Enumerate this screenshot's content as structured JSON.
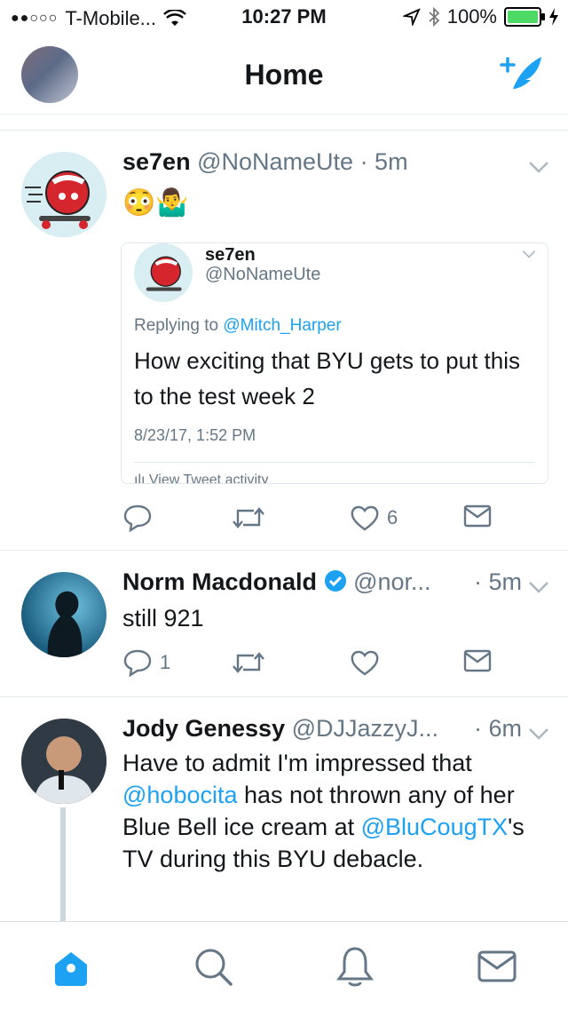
{
  "status_bar": {
    "signal": "●●○○○",
    "carrier": "T-Mobile...",
    "time": "10:27 PM",
    "battery": "100%"
  },
  "header": {
    "title": "Home"
  },
  "tweets": [
    {
      "name": "se7en",
      "handle": "@NoNameUte",
      "time": "· 5m",
      "text": "😳🤷‍♂️",
      "quote": {
        "name": "se7en",
        "handle": "@NoNameUte",
        "reply_prefix": "Replying to ",
        "reply_to": "@Mitch_Harper",
        "text": "How exciting that BYU gets to put this to the test week 2",
        "date": "8/23/17, 1:52 PM",
        "cut_text": "ılı View Tweet activity"
      },
      "likes": "6"
    },
    {
      "name": "Norm Macdonald",
      "handle": "@nor...",
      "time": "· 5m",
      "text": "still 921",
      "replies": "1"
    },
    {
      "name": "Jody Genessy",
      "handle": "@DJJazzyJ...",
      "time": "· 6m",
      "text_parts": [
        "Have to admit I'm impressed that ",
        "@hobocita",
        " has not thrown any of her Blue Bell ice cream at ",
        "@BluCougTX",
        "'s TV during this BYU debacle."
      ]
    }
  ],
  "tabbar": [
    "home-icon",
    "search-icon",
    "notifications-icon",
    "messages-icon"
  ],
  "colors": {
    "accent": "#1da1f2",
    "gray": "#657786",
    "verified": "#1da1f2"
  }
}
